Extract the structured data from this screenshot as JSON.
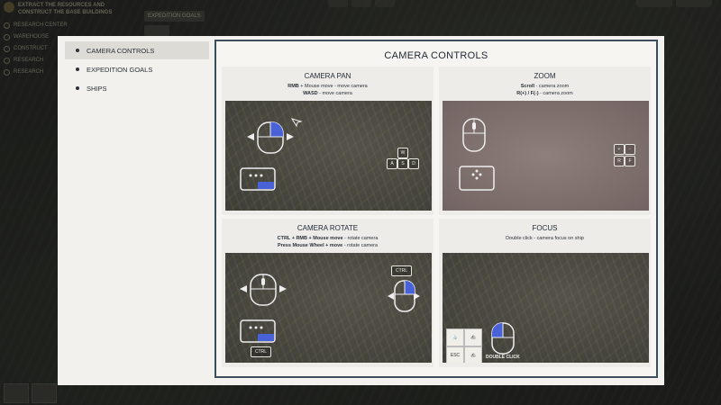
{
  "background": {
    "quest_title": "EXTRACT THE RESOURCES AND CONSTRUCT THE BASE BUILDINGS",
    "quest_items": [
      "RESEARCH CENTER",
      "WAREHOUSE",
      "CONSTRUCT",
      "RESEARCH",
      "RESEARCH"
    ],
    "chip_label": "EXPEDITION GOALS"
  },
  "sidebar": {
    "items": [
      {
        "label": "CAMERA CONTROLS"
      },
      {
        "label": "EXPEDITION GOALS"
      },
      {
        "label": "SHIPS"
      }
    ],
    "active_index": 0
  },
  "content": {
    "title": "CAMERA CONTROLS",
    "panels": {
      "pan": {
        "title": "CAMERA PAN",
        "line1_key": "RMB",
        "line1_text": " + Mouse move - move camera",
        "line2_key": "WASD",
        "line2_text": " - move camera",
        "keys": [
          "W",
          "A",
          "S",
          "D"
        ]
      },
      "zoom": {
        "title": "ZOOM",
        "line1_key": "Scroll",
        "line1_text": " - camera zoom",
        "line2_key": "R(+) / F(-)",
        "line2_text": " - camera zoom",
        "keys": [
          "+",
          "-",
          "R",
          "F"
        ]
      },
      "rotate": {
        "title": "CAMERA ROTATE",
        "line1_key": "CTRL + RMB + Mouse move",
        "line1_text": " - rotate camera",
        "line2_key": "Press Mouse Wheel + move",
        "line2_text": " - rotate camera",
        "ctrl_label": "CTRL"
      },
      "focus": {
        "title": "FOCUS",
        "desc": "Double click - camera focus on ship",
        "esc_label": "ESC",
        "dbl_label": "DOUBLE CLICK"
      }
    }
  },
  "colors": {
    "accent_blue": "#4a62d8",
    "frame_border": "#3d4d60",
    "modal_bg": "#f2f1ee"
  }
}
